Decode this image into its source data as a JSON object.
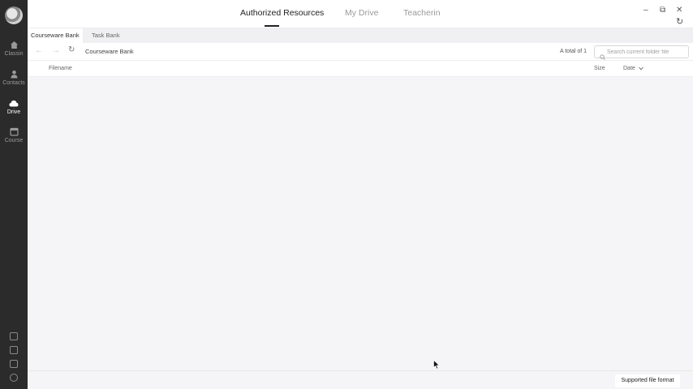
{
  "sidebar": {
    "items": [
      {
        "label": "Classin",
        "icon": "home-icon"
      },
      {
        "label": "Contacts",
        "icon": "person-icon"
      },
      {
        "label": "Drive",
        "icon": "cloud-icon"
      },
      {
        "label": "Course",
        "icon": "calendar-icon"
      }
    ],
    "active": "Drive"
  },
  "header": {
    "tabs": [
      {
        "label": "Authorized Resources"
      },
      {
        "label": "My Drive"
      },
      {
        "label": "Teacherin"
      }
    ],
    "active_tab": "Authorized Resources"
  },
  "window": {
    "minimize": "–",
    "restore": "⧉",
    "close": "✕",
    "refresh": "↻"
  },
  "subtabs": [
    {
      "label": "Courseware Bank"
    },
    {
      "label": "Task Bank"
    }
  ],
  "toolbar": {
    "back": "←",
    "forward": "→",
    "refresh": "↻",
    "path": "Courseware Bank",
    "total": "A total of 1",
    "search_placeholder": "Search current folder file"
  },
  "columns": {
    "filename": "Filename",
    "size": "Size",
    "date": "Date"
  },
  "footer": {
    "format_button": "Supported file format"
  },
  "colors": {
    "sidebar": "#2b2b2b",
    "accent": "#222222",
    "background": "#f5f5f7"
  }
}
